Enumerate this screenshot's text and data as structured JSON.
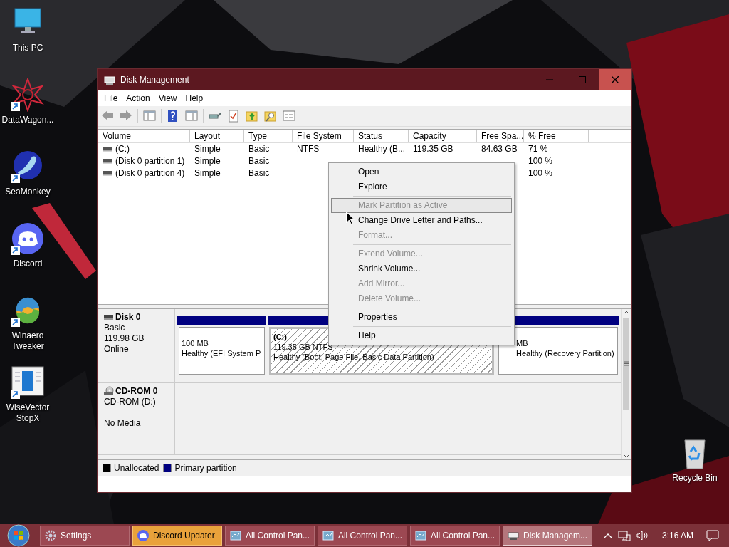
{
  "desktop_icons": [
    {
      "label": "This PC",
      "kind": "monitor",
      "shortcut": false
    },
    {
      "label": "DataWagon...",
      "kind": "star",
      "shortcut": true
    },
    {
      "label": "SeaMonkey",
      "kind": "bird",
      "shortcut": true
    },
    {
      "label": "Discord",
      "kind": "discord",
      "shortcut": true
    },
    {
      "label": "Winaero Tweaker",
      "kind": "swirl",
      "shortcut": true
    },
    {
      "label": "WiseVector StopX",
      "kind": "document",
      "shortcut": true
    }
  ],
  "recycle_bin": {
    "label": "Recycle Bin"
  },
  "window": {
    "title": "Disk Management"
  },
  "menu_bar": [
    "File",
    "Action",
    "View",
    "Help"
  ],
  "volume_list": {
    "columns": [
      "Volume",
      "Layout",
      "Type",
      "File System",
      "Status",
      "Capacity",
      "Free Spa...",
      "% Free"
    ],
    "rows": [
      {
        "cells": [
          "(C:)",
          "Simple",
          "Basic",
          "NTFS",
          "Healthy (B...",
          "119.35 GB",
          "84.63 GB",
          "71 %"
        ]
      },
      {
        "cells": [
          "(Disk 0 partition 1)",
          "Simple",
          "Basic",
          "",
          "",
          "",
          "",
          "100 %"
        ]
      },
      {
        "cells": [
          "(Disk 0 partition 4)",
          "Simple",
          "Basic",
          "",
          "",
          "",
          "",
          "100 %"
        ]
      }
    ]
  },
  "disks": [
    {
      "name": "Disk 0",
      "kind": "disk",
      "type": "Basic",
      "size": "119.98 GB",
      "status": "Online",
      "partitions": [
        {
          "size": "100 MB",
          "status": "Healthy (EFI System P",
          "selected": false
        },
        {
          "label": "(C:)",
          "size": "119.35 GB NTFS",
          "status": "Healthy (Boot, Page File, Basic Data Partition)",
          "selected": true
        },
        {
          "size": "MB",
          "status": "Healthy (Recovery Partition)",
          "selected": false
        }
      ]
    },
    {
      "name": "CD-ROM 0",
      "kind": "cdrom",
      "type": "CD-ROM (D:)",
      "status": "No Media"
    }
  ],
  "legend": [
    {
      "label": "Unallocated",
      "color": "#000000"
    },
    {
      "label": "Primary partition",
      "color": "#000080"
    }
  ],
  "context_menu": [
    {
      "kind": "item",
      "label": "Open",
      "disabled": false,
      "selected": false
    },
    {
      "kind": "item",
      "label": "Explore",
      "disabled": false,
      "selected": false
    },
    {
      "kind": "separator"
    },
    {
      "kind": "item",
      "label": "Mark Partition as Active",
      "disabled": true,
      "selected": true
    },
    {
      "kind": "item",
      "label": "Change Drive Letter and Paths...",
      "disabled": false,
      "selected": false
    },
    {
      "kind": "item",
      "label": "Format...",
      "disabled": true,
      "selected": false
    },
    {
      "kind": "separator"
    },
    {
      "kind": "item",
      "label": "Extend Volume...",
      "disabled": true,
      "selected": false
    },
    {
      "kind": "item",
      "label": "Shrink Volume...",
      "disabled": false,
      "selected": false
    },
    {
      "kind": "item",
      "label": "Add Mirror...",
      "disabled": true,
      "selected": false
    },
    {
      "kind": "item",
      "label": "Delete Volume...",
      "disabled": true,
      "selected": false
    },
    {
      "kind": "separator"
    },
    {
      "kind": "item",
      "label": "Properties",
      "disabled": false,
      "selected": false
    },
    {
      "kind": "separator"
    },
    {
      "kind": "item",
      "label": "Help",
      "disabled": false,
      "selected": false
    }
  ],
  "taskbar": {
    "buttons": [
      {
        "label": "Settings",
        "kind": "gear",
        "selected": false,
        "flashing": false
      },
      {
        "label": "Discord Updater",
        "kind": "discord",
        "selected": false,
        "flashing": true
      },
      {
        "label": "All Control Pan...",
        "kind": "panel",
        "selected": false,
        "flashing": false
      },
      {
        "label": "All Control Pan...",
        "kind": "panel",
        "selected": false,
        "flashing": false
      },
      {
        "label": "All Control Pan...",
        "kind": "panel",
        "selected": false,
        "flashing": false
      },
      {
        "label": "Disk Managem...",
        "kind": "disk",
        "selected": true,
        "flashing": false
      }
    ],
    "clock": "3:16 AM"
  }
}
